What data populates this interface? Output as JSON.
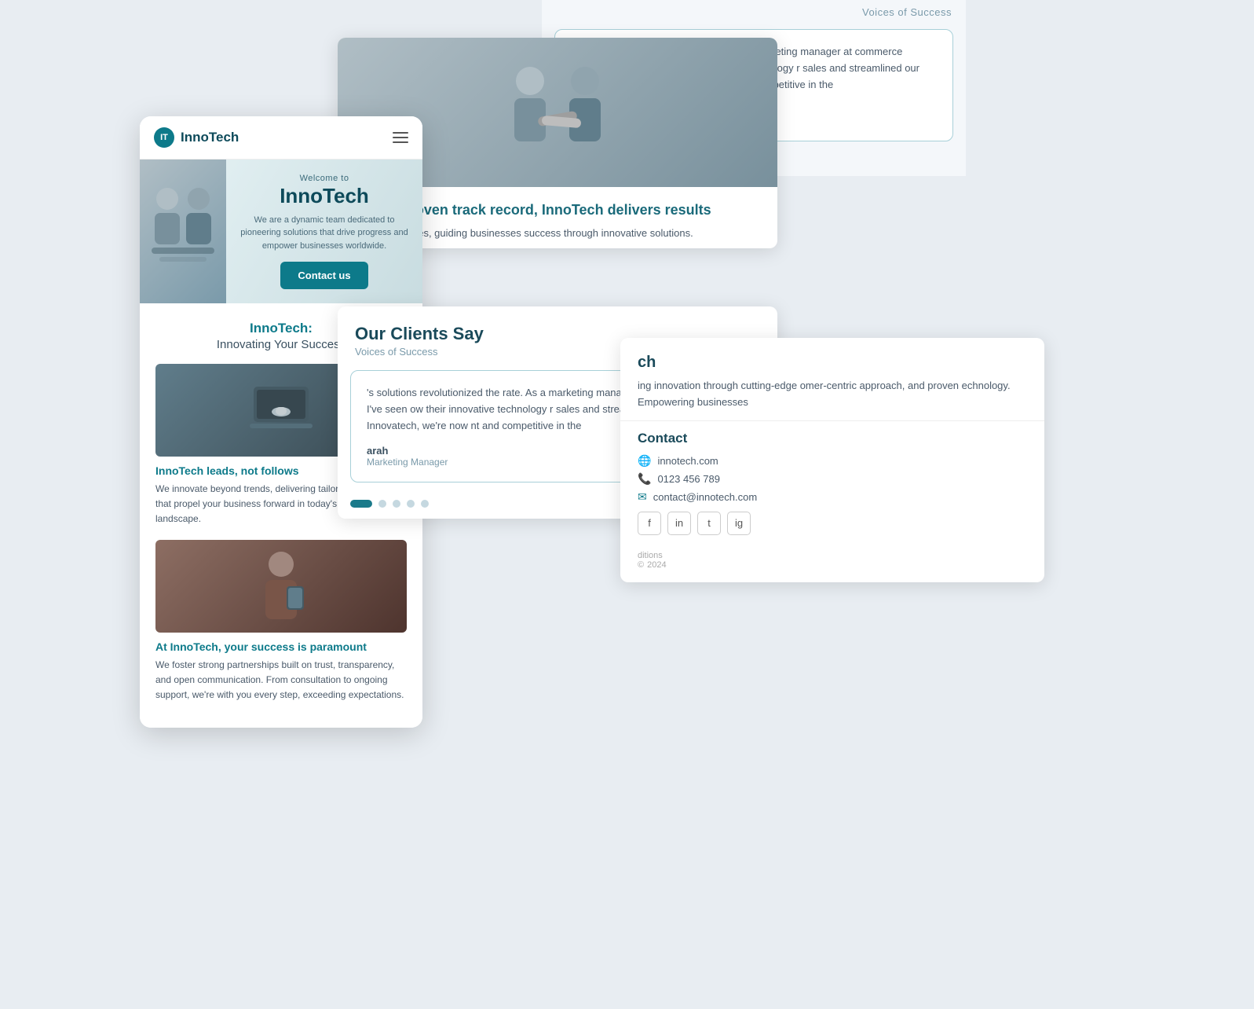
{
  "app": {
    "title": "InnoTech"
  },
  "back_layer": {
    "section_title": "Voices of Success",
    "testimonial": {
      "text": "'s solutions revolutionized the rate. As a marketing manager at commerce platform, I've seen ow their innovative technology r sales and streamlined our Thanks to Innovatech, we're now nt and competitive in the",
      "author": "arah",
      "role": "Marketing Manager"
    },
    "dots": [
      "active",
      "inactive",
      "inactive",
      "inactive",
      "inactive"
    ]
  },
  "mid_layer": {
    "hero_alt": "Two businessmen shaking hands",
    "headline": "With a proven track record, InnoTech delivers results",
    "description": "spans industries, guiding businesses success through innovative solutions."
  },
  "mobile": {
    "logo": "InnoTech",
    "logo_short": "IT",
    "nav_icon": "hamburger",
    "hero": {
      "welcome": "Welcome to",
      "title": "InnoTech",
      "subtitle": "We are a dynamic team dedicated to pioneering solutions that drive progress and empower businesses worldwide.",
      "cta": "Contact us"
    },
    "section": {
      "heading": "InnoTech:",
      "subheading": "Innovating Your Success",
      "feature1": {
        "title": "InnoTech leads, not follows",
        "description": "We innovate beyond trends, delivering tailored solutions that propel your business forward in today's digital landscape."
      },
      "feature2": {
        "title": "At InnoTech, your success is paramount",
        "description": "We foster strong partnerships built on trust, transparency, and open communication. From consultation to ongoing support, we're with you every step, exceeding expectations."
      }
    }
  },
  "clients_layer": {
    "heading": "Our Clients Say",
    "subtitle": "Voices of Success",
    "testimonial": {
      "text": "'s solutions revolutionized the rate. As a marketing manager at commerce platform, I've seen ow their innovative technology r sales and streamlined our Thanks to Innovatech, we're now nt and competitive in the",
      "author": "arah",
      "role": "Marketing Manager"
    },
    "dots": [
      "active",
      "inactive",
      "inactive",
      "inactive",
      "inactive"
    ]
  },
  "right_layer": {
    "company_name": "ch",
    "company_description": "ing innovation through cutting-edge omer-centric approach, and proven echnology. Empowering businesses",
    "contact": {
      "title": "Contact",
      "website": "innotech.com",
      "phone": "0123 456 789",
      "email": "contact@innotech.com"
    },
    "social": [
      "f",
      "in",
      "t",
      "ig"
    ],
    "footer": {
      "terms": "ditions",
      "copyright": "2024"
    }
  }
}
